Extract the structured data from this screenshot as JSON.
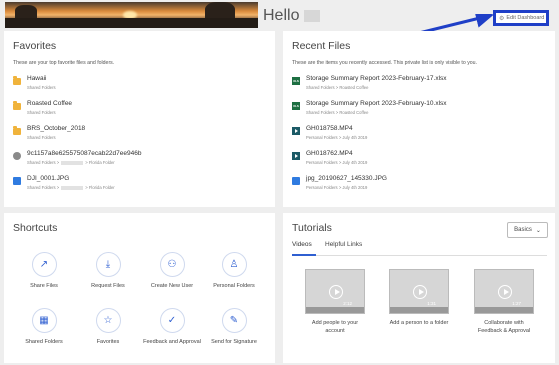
{
  "header": {
    "greeting": "Hello",
    "edit_dashboard_label": "Edit Dashboard"
  },
  "favorites": {
    "title": "Favorites",
    "subtitle": "These are your top favorite files and folders.",
    "items": [
      {
        "name": "Hawaii",
        "path": "Shared Folders",
        "icon": "folder-icon"
      },
      {
        "name": "Roasted Coffee",
        "path": "Shared Folders",
        "icon": "folder-icon"
      },
      {
        "name": "BRS_October_2018",
        "path": "Shared Folders",
        "icon": "folder-icon"
      },
      {
        "name": "9c1157a8e625575087ecab22d7ee946b",
        "path_start": "Shared Folders >",
        "path_end": "> Florida Folder",
        "icon": "file-icon"
      },
      {
        "name": "DJI_0001.JPG",
        "path_start": "Shared Folders >",
        "path_end": "> Florida Folder",
        "icon": "image-icon"
      }
    ]
  },
  "recent": {
    "title": "Recent Files",
    "subtitle": "These are the items you recently accessed. This private list is only visible to you.",
    "items": [
      {
        "name": "Storage Summary Report 2023-February-17.xlsx",
        "path": "Shared Folders > Roasted Coffee",
        "icon": "excel-icon",
        "badge": "XLS"
      },
      {
        "name": "Storage Summary Report 2023-February-10.xlsx",
        "path": "Shared Folders > Roasted Coffee",
        "icon": "excel-icon",
        "badge": "XLS"
      },
      {
        "name": "GH018758.MP4",
        "path": "Personal Folders > July 4th 2019",
        "icon": "video-icon"
      },
      {
        "name": "GH018762.MP4",
        "path": "Personal Folders > July 4th 2019",
        "icon": "video-icon"
      },
      {
        "name": "jpg_20190627_145330.JPG",
        "path": "Personal Folders > July 4th 2019",
        "icon": "image-icon"
      }
    ]
  },
  "shortcuts": {
    "title": "Shortcuts",
    "items": [
      {
        "label": "Share Files",
        "icon": "share-icon",
        "glyph": "↗"
      },
      {
        "label": "Request Files",
        "icon": "request-icon",
        "glyph": "⤓"
      },
      {
        "label": "Create New User",
        "icon": "add-user-icon",
        "glyph": "⚇"
      },
      {
        "label": "Personal Folders",
        "icon": "person-icon",
        "glyph": "♙"
      },
      {
        "label": "Shared Folders",
        "icon": "shared-folder-icon",
        "glyph": "▦"
      },
      {
        "label": "Favorites",
        "icon": "star-icon",
        "glyph": "☆"
      },
      {
        "label": "Feedback and Approval",
        "icon": "check-circle-icon",
        "glyph": "✓"
      },
      {
        "label": "Send for Signature",
        "icon": "pen-icon",
        "glyph": "✎"
      }
    ]
  },
  "tutorials": {
    "title": "Tutorials",
    "dropdown_value": "Basics",
    "tabs": [
      "Videos",
      "Helpful Links"
    ],
    "videos": [
      {
        "caption": "Add people to your account",
        "duration": "2:12"
      },
      {
        "caption": "Add a person to a folder",
        "duration": "1:31"
      },
      {
        "caption": "Collaborate with Feedback & Approval",
        "duration": "1:27"
      }
    ]
  },
  "colors": {
    "accent": "#2f5fd1",
    "highlight_box": "#1f3fc7",
    "folder": "#f0b33b",
    "excel": "#1d6f42"
  }
}
